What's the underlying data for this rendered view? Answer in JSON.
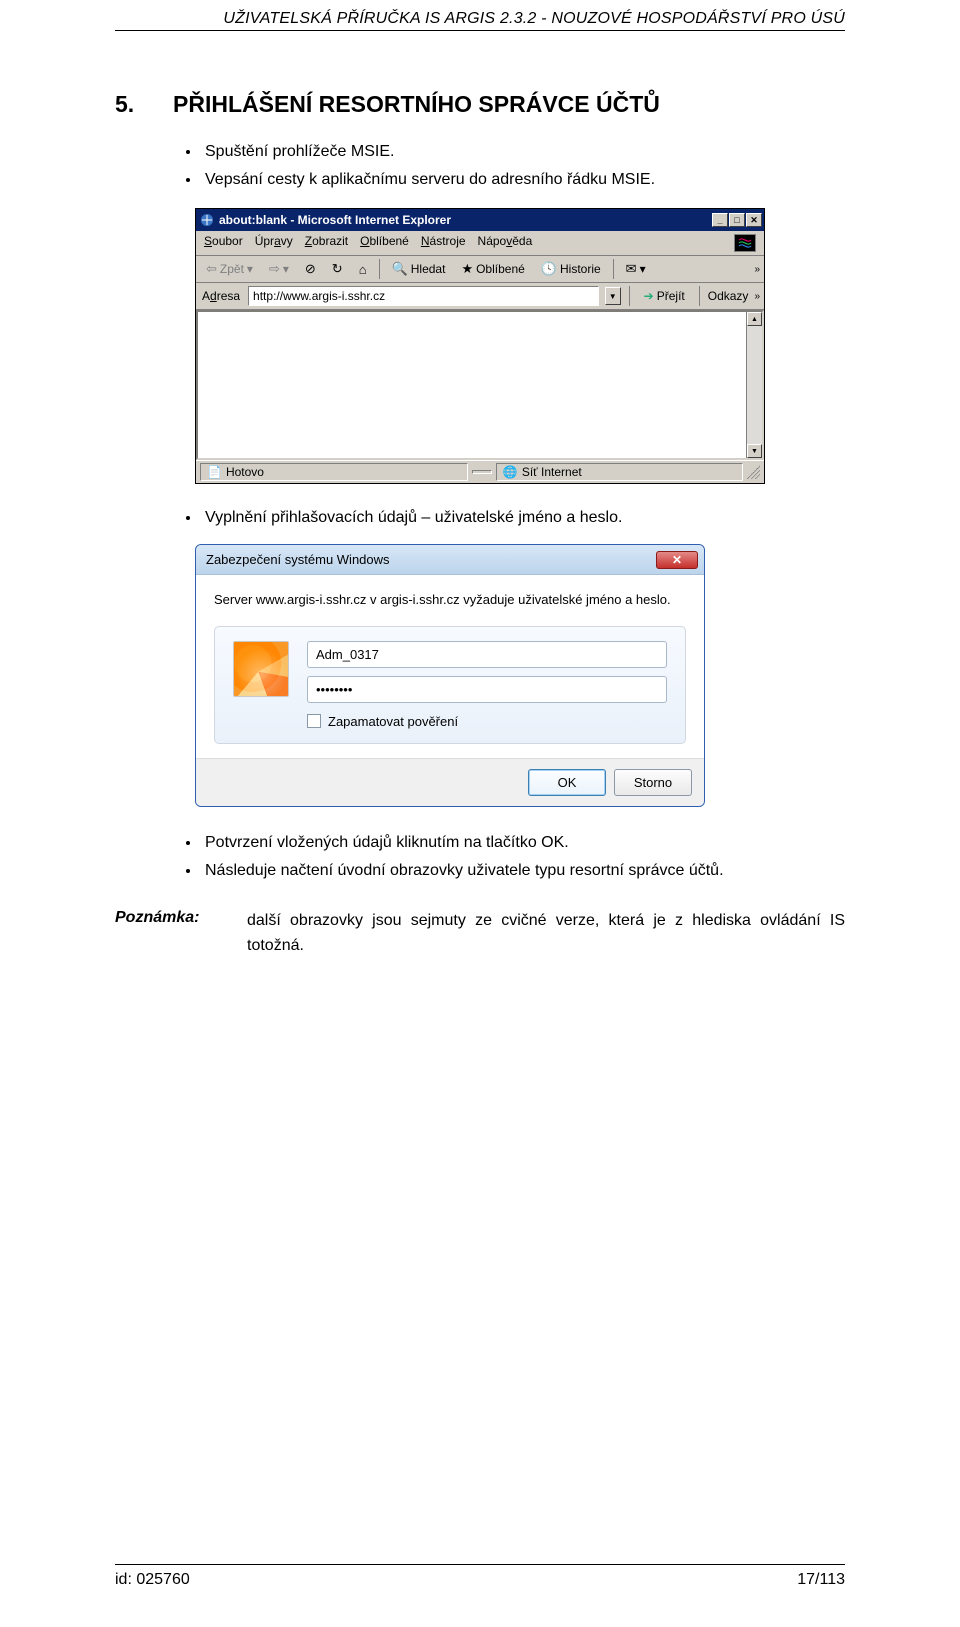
{
  "header": "UŽIVATELSKÁ PŘÍRUČKA IS ARGIS 2.3.2 - NOUZOVÉ HOSPODÁŘSTVÍ PRO ÚSÚ",
  "section": {
    "num": "5.",
    "title": "PŘIHLÁŠENÍ RESORTNÍHO SPRÁVCE ÚČTŮ"
  },
  "bullets1": [
    "Spuštění prohlížeče MSIE.",
    "Vepsání cesty k aplikačnímu serveru do adresního řádku MSIE."
  ],
  "ie": {
    "title": "about:blank - Microsoft Internet Explorer",
    "menu": {
      "soubor": "Soubor",
      "upravy": "Úpravy",
      "zobrazit": "Zobrazit",
      "oblibene": "Oblíbené",
      "nastroje": "Nástroje",
      "napoveda": "Nápověda"
    },
    "toolbar": {
      "zpet": "Zpět",
      "hledat": "Hledat",
      "oblibene": "Oblíbené",
      "historie": "Historie"
    },
    "addr_label": "Adresa",
    "addr_value": "http://www.argis-i.sshr.cz",
    "go": "Přejít",
    "links": "Odkazy",
    "status_left": "Hotovo",
    "status_right": "Síť Internet"
  },
  "bullets2": [
    "Vyplnění přihlašovacích údajů – uživatelské jméno a heslo."
  ],
  "w7": {
    "title": "Zabezpečení systému Windows",
    "msg": "Server www.argis-i.sshr.cz v argis-i.sshr.cz vyžaduje uživatelské jméno a heslo.",
    "user": "Adm_0317",
    "pass": "••••••••",
    "remember": "Zapamatovat pověření",
    "ok": "OK",
    "cancel": "Storno"
  },
  "bullets3": [
    "Potvrzení vložených údajů kliknutím na tlačítko OK.",
    "Následuje načtení úvodní obrazovky uživatele typu resortní správce účtů."
  ],
  "poznamka": {
    "label": "Poznámka:",
    "text": "další obrazovky jsou sejmuty ze cvičné verze, která je z hlediska ovládání IS totožná."
  },
  "footer": {
    "left": "id: 025760",
    "right": "17/113"
  }
}
